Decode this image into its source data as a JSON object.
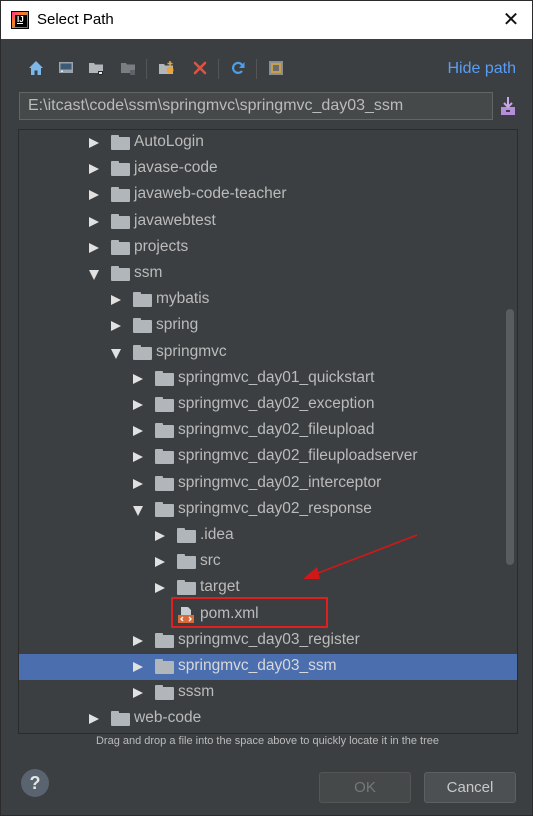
{
  "window": {
    "title": "Select Path",
    "close_glyph": "✕"
  },
  "toolbar": {
    "icons": [
      "home-icon",
      "desktop-icon",
      "project-icon",
      "module-icon",
      "new-folder-icon",
      "delete-icon",
      "refresh-icon",
      "show-hidden-icon"
    ],
    "hide_path_label": "Hide path"
  },
  "path": {
    "value": "E:\\itcast\\code\\ssm\\springmvc\\springmvc_day03_ssm"
  },
  "tree": {
    "items": [
      {
        "label": "AutoLogin",
        "depth": 0,
        "state": "collapsed",
        "type": "folder"
      },
      {
        "label": "javase-code",
        "depth": 0,
        "state": "collapsed",
        "type": "folder"
      },
      {
        "label": "javaweb-code-teacher",
        "depth": 0,
        "state": "collapsed",
        "type": "folder"
      },
      {
        "label": "javawebtest",
        "depth": 0,
        "state": "collapsed",
        "type": "folder"
      },
      {
        "label": "projects",
        "depth": 0,
        "state": "collapsed",
        "type": "folder"
      },
      {
        "label": "ssm",
        "depth": 0,
        "state": "expanded",
        "type": "folder"
      },
      {
        "label": "mybatis",
        "depth": 1,
        "state": "collapsed",
        "type": "folder"
      },
      {
        "label": "spring",
        "depth": 1,
        "state": "collapsed",
        "type": "folder"
      },
      {
        "label": "springmvc",
        "depth": 1,
        "state": "expanded",
        "type": "folder"
      },
      {
        "label": "springmvc_day01_quickstart",
        "depth": 2,
        "state": "collapsed",
        "type": "folder"
      },
      {
        "label": "springmvc_day02_exception",
        "depth": 2,
        "state": "collapsed",
        "type": "folder"
      },
      {
        "label": "springmvc_day02_fileupload",
        "depth": 2,
        "state": "collapsed",
        "type": "folder"
      },
      {
        "label": "springmvc_day02_fileuploadserver",
        "depth": 2,
        "state": "collapsed",
        "type": "folder"
      },
      {
        "label": "springmvc_day02_interceptor",
        "depth": 2,
        "state": "collapsed",
        "type": "folder"
      },
      {
        "label": "springmvc_day02_response",
        "depth": 2,
        "state": "expanded",
        "type": "folder"
      },
      {
        "label": ".idea",
        "depth": 3,
        "state": "collapsed",
        "type": "folder"
      },
      {
        "label": "src",
        "depth": 3,
        "state": "collapsed",
        "type": "folder"
      },
      {
        "label": "target",
        "depth": 3,
        "state": "collapsed",
        "type": "folder"
      },
      {
        "label": "pom.xml",
        "depth": 3,
        "state": "leaf",
        "type": "file"
      },
      {
        "label": "springmvc_day03_register",
        "depth": 2,
        "state": "collapsed",
        "type": "folder"
      },
      {
        "label": "springmvc_day03_ssm",
        "depth": 2,
        "state": "collapsed",
        "type": "folder",
        "selected": true
      },
      {
        "label": "sssm",
        "depth": 2,
        "state": "collapsed",
        "type": "folder"
      },
      {
        "label": "web-code",
        "depth": 0,
        "state": "collapsed",
        "type": "folder"
      }
    ]
  },
  "hint": "Drag and drop a file into the space above to quickly locate it in the tree",
  "footer": {
    "help": "?",
    "ok": "OK",
    "cancel": "Cancel"
  },
  "colors": {
    "selection": "#4b6eaf",
    "link": "#589df6",
    "annotation": "#e02020",
    "background": "#3c3f41"
  }
}
